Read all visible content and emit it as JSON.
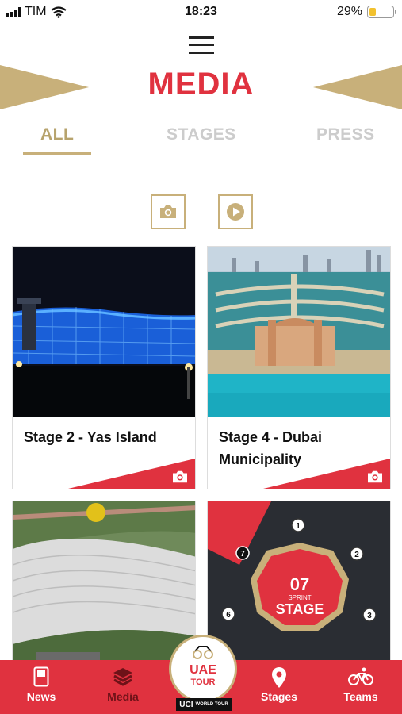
{
  "status": {
    "carrier": "TIM",
    "time": "18:23",
    "battery_text": "29%",
    "battery_level": 0.29
  },
  "header": {
    "title": "MEDIA"
  },
  "tabs": [
    {
      "label": "ALL",
      "active": true
    },
    {
      "label": "STAGES",
      "active": false
    },
    {
      "label": "PRESS",
      "active": false
    }
  ],
  "filters": {
    "photo_icon": "camera-icon",
    "video_icon": "play-icon"
  },
  "cards": [
    {
      "title": "Stage 2 - Yas Island",
      "type_icon": "camera-icon"
    },
    {
      "title": "Stage 4 - Dubai Municipality",
      "type_icon": "camera-icon"
    },
    {
      "title": "",
      "type_icon": ""
    },
    {
      "title": "",
      "type_icon": ""
    }
  ],
  "sprint_graphic": {
    "number": "07",
    "small": "SPRINT",
    "big": "STAGE",
    "markers": [
      "1",
      "2",
      "3",
      "6",
      "7"
    ]
  },
  "nav": {
    "items": [
      {
        "label": "News",
        "icon": "news-icon"
      },
      {
        "label": "Media",
        "icon": "layers-icon",
        "active": true
      },
      {
        "label": "Stages",
        "icon": "location-pin-icon"
      },
      {
        "label": "Teams",
        "icon": "bicycle-icon"
      }
    ],
    "logo_line1": "UAE",
    "logo_line2": "TOUR",
    "uci_text": "UCI",
    "uci_sub": "WORLD TOUR"
  },
  "colors": {
    "accent_red": "#e0323f",
    "gold": "#c8b07a"
  }
}
